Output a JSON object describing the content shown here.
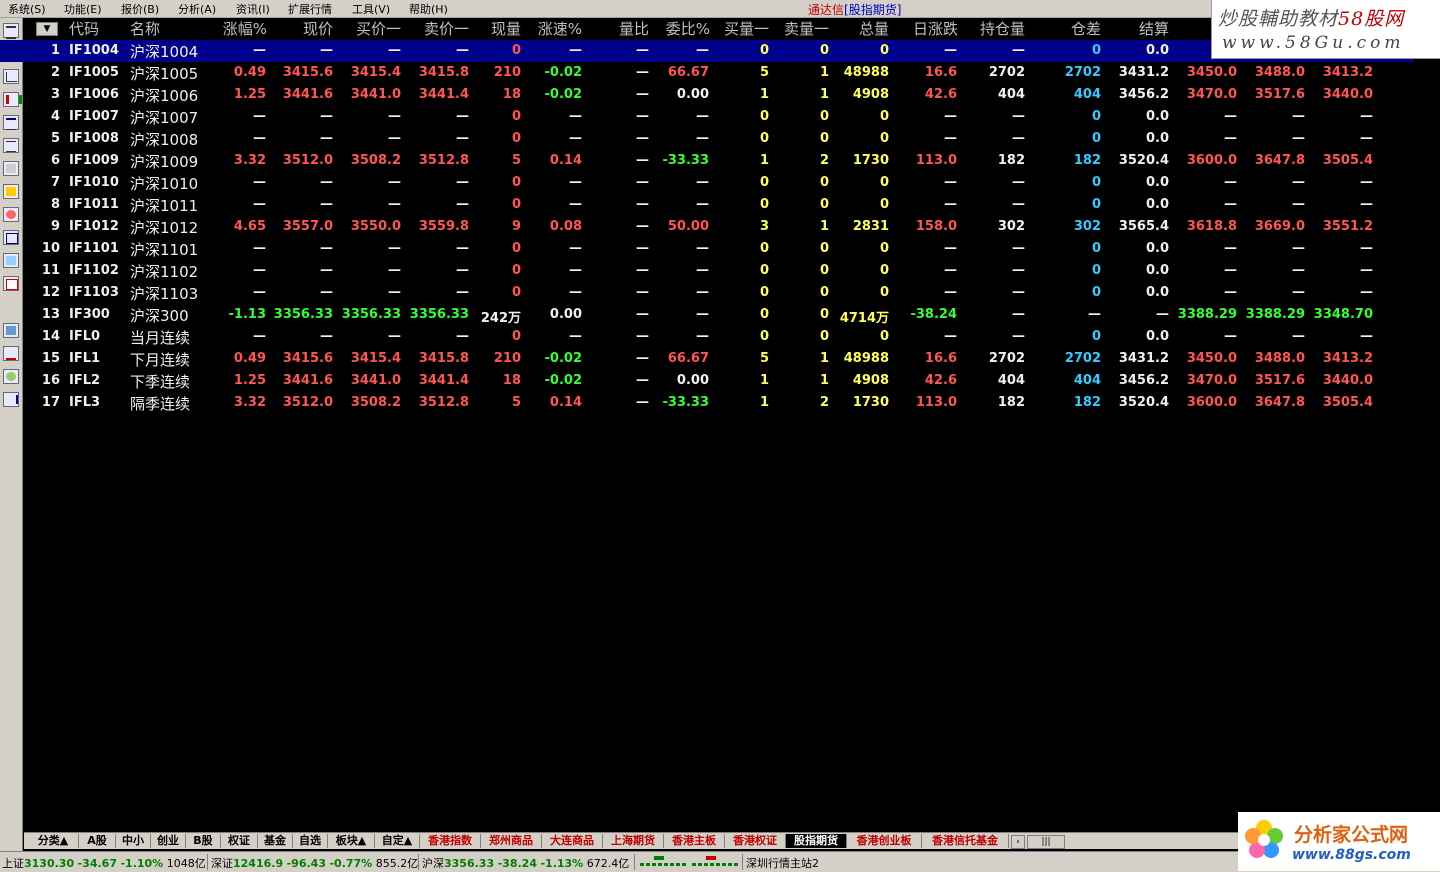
{
  "menu": {
    "items": [
      "系统(S)",
      "功能(E)",
      "报价(B)",
      "分析(A)",
      "资讯(I)",
      "扩展行情",
      "工具(V)",
      "帮助(H)"
    ],
    "app_title": "通达信",
    "app_subtitle": "[股指期货]"
  },
  "watermark_top": {
    "line1_a": "炒股輔助教材",
    "line1_b": "58股网",
    "line2": "www.58Gu.com"
  },
  "header": [
    "代码",
    "名称",
    "涨幅%",
    "现价",
    "买价一",
    "卖价一",
    "现量",
    "涨速%",
    "量比",
    "委比%",
    "买量一",
    "卖量一",
    "总量",
    "日涨跌",
    "持仓量",
    "仓差",
    "结算"
  ],
  "rows": [
    {
      "n": "1",
      "code": "IF1004",
      "name": "沪深1004",
      "chg": "—",
      "price": "—",
      "bid": "—",
      "ask": "—",
      "vol": "0",
      "speed": "—",
      "vr": "—",
      "wb": "—",
      "bv": "0",
      "av": "0",
      "tot": "0",
      "dchg": "—",
      "oi": "—",
      "oid": "0",
      "settle": "0.0",
      "x1": "—",
      "x2": "—",
      "x3": "—",
      "sel": true
    },
    {
      "n": "2",
      "code": "IF1005",
      "name": "沪深1005",
      "chg": "0.49",
      "price": "3415.6",
      "bid": "3415.4",
      "ask": "3415.8",
      "vol": "210",
      "speed": "-0.02",
      "vr": "—",
      "wb": "66.67",
      "bv": "5",
      "av": "1",
      "tot": "48988",
      "dchg": "16.6",
      "oi": "2702",
      "oid": "2702",
      "settle": "3431.2",
      "x1": "3450.0",
      "x2": "3488.0",
      "x3": "3413.2"
    },
    {
      "n": "3",
      "code": "IF1006",
      "name": "沪深1006",
      "chg": "1.25",
      "price": "3441.6",
      "bid": "3441.0",
      "ask": "3441.4",
      "vol": "18",
      "speed": "-0.02",
      "vr": "—",
      "wb": "0.00",
      "bv": "1",
      "av": "1",
      "tot": "4908",
      "dchg": "42.6",
      "oi": "404",
      "oid": "404",
      "settle": "3456.2",
      "x1": "3470.0",
      "x2": "3517.6",
      "x3": "3440.0"
    },
    {
      "n": "4",
      "code": "IF1007",
      "name": "沪深1007",
      "chg": "—",
      "price": "—",
      "bid": "—",
      "ask": "—",
      "vol": "0",
      "speed": "—",
      "vr": "—",
      "wb": "—",
      "bv": "0",
      "av": "0",
      "tot": "0",
      "dchg": "—",
      "oi": "—",
      "oid": "0",
      "settle": "0.0",
      "x1": "—",
      "x2": "—",
      "x3": "—"
    },
    {
      "n": "5",
      "code": "IF1008",
      "name": "沪深1008",
      "chg": "—",
      "price": "—",
      "bid": "—",
      "ask": "—",
      "vol": "0",
      "speed": "—",
      "vr": "—",
      "wb": "—",
      "bv": "0",
      "av": "0",
      "tot": "0",
      "dchg": "—",
      "oi": "—",
      "oid": "0",
      "settle": "0.0",
      "x1": "—",
      "x2": "—",
      "x3": "—"
    },
    {
      "n": "6",
      "code": "IF1009",
      "name": "沪深1009",
      "chg": "3.32",
      "price": "3512.0",
      "bid": "3508.2",
      "ask": "3512.8",
      "vol": "5",
      "speed": "0.14",
      "vr": "—",
      "wb": "-33.33",
      "bv": "1",
      "av": "2",
      "tot": "1730",
      "dchg": "113.0",
      "oi": "182",
      "oid": "182",
      "settle": "3520.4",
      "x1": "3600.0",
      "x2": "3647.8",
      "x3": "3505.4"
    },
    {
      "n": "7",
      "code": "IF1010",
      "name": "沪深1010",
      "chg": "—",
      "price": "—",
      "bid": "—",
      "ask": "—",
      "vol": "0",
      "speed": "—",
      "vr": "—",
      "wb": "—",
      "bv": "0",
      "av": "0",
      "tot": "0",
      "dchg": "—",
      "oi": "—",
      "oid": "0",
      "settle": "0.0",
      "x1": "—",
      "x2": "—",
      "x3": "—"
    },
    {
      "n": "8",
      "code": "IF1011",
      "name": "沪深1011",
      "chg": "—",
      "price": "—",
      "bid": "—",
      "ask": "—",
      "vol": "0",
      "speed": "—",
      "vr": "—",
      "wb": "—",
      "bv": "0",
      "av": "0",
      "tot": "0",
      "dchg": "—",
      "oi": "—",
      "oid": "0",
      "settle": "0.0",
      "x1": "—",
      "x2": "—",
      "x3": "—"
    },
    {
      "n": "9",
      "code": "IF1012",
      "name": "沪深1012",
      "chg": "4.65",
      "price": "3557.0",
      "bid": "3550.0",
      "ask": "3559.8",
      "vol": "9",
      "speed": "0.08",
      "vr": "—",
      "wb": "50.00",
      "bv": "3",
      "av": "1",
      "tot": "2831",
      "dchg": "158.0",
      "oi": "302",
      "oid": "302",
      "settle": "3565.4",
      "x1": "3618.8",
      "x2": "3669.0",
      "x3": "3551.2"
    },
    {
      "n": "10",
      "code": "IF1101",
      "name": "沪深1101",
      "chg": "—",
      "price": "—",
      "bid": "—",
      "ask": "—",
      "vol": "0",
      "speed": "—",
      "vr": "—",
      "wb": "—",
      "bv": "0",
      "av": "0",
      "tot": "0",
      "dchg": "—",
      "oi": "—",
      "oid": "0",
      "settle": "0.0",
      "x1": "—",
      "x2": "—",
      "x3": "—"
    },
    {
      "n": "11",
      "code": "IF1102",
      "name": "沪深1102",
      "chg": "—",
      "price": "—",
      "bid": "—",
      "ask": "—",
      "vol": "0",
      "speed": "—",
      "vr": "—",
      "wb": "—",
      "bv": "0",
      "av": "0",
      "tot": "0",
      "dchg": "—",
      "oi": "—",
      "oid": "0",
      "settle": "0.0",
      "x1": "—",
      "x2": "—",
      "x3": "—"
    },
    {
      "n": "12",
      "code": "IF1103",
      "name": "沪深1103",
      "chg": "—",
      "price": "—",
      "bid": "—",
      "ask": "—",
      "vol": "0",
      "speed": "—",
      "vr": "—",
      "wb": "—",
      "bv": "0",
      "av": "0",
      "tot": "0",
      "dchg": "—",
      "oi": "—",
      "oid": "0",
      "settle": "0.0",
      "x1": "—",
      "x2": "—",
      "x3": "—"
    },
    {
      "n": "13",
      "code": "IF300",
      "name": "沪深300",
      "chg": "-1.13",
      "price": "3356.33",
      "bid": "3356.33",
      "ask": "3356.33",
      "vol": "242万",
      "speed": "0.00",
      "vr": "—",
      "wb": "—",
      "bv": "0",
      "av": "0",
      "tot": "4714万",
      "dchg": "-38.24",
      "oi": "—",
      "oid": "—",
      "settle": "—",
      "x1": "3388.29",
      "x2": "3388.29",
      "x3": "3348.70",
      "index": true
    },
    {
      "n": "14",
      "code": "IFL0",
      "name": "当月连续",
      "chg": "—",
      "price": "—",
      "bid": "—",
      "ask": "—",
      "vol": "0",
      "speed": "—",
      "vr": "—",
      "wb": "—",
      "bv": "0",
      "av": "0",
      "tot": "0",
      "dchg": "—",
      "oi": "—",
      "oid": "0",
      "settle": "0.0",
      "x1": "—",
      "x2": "—",
      "x3": "—"
    },
    {
      "n": "15",
      "code": "IFL1",
      "name": "下月连续",
      "chg": "0.49",
      "price": "3415.6",
      "bid": "3415.4",
      "ask": "3415.8",
      "vol": "210",
      "speed": "-0.02",
      "vr": "—",
      "wb": "66.67",
      "bv": "5",
      "av": "1",
      "tot": "48988",
      "dchg": "16.6",
      "oi": "2702",
      "oid": "2702",
      "settle": "3431.2",
      "x1": "3450.0",
      "x2": "3488.0",
      "x3": "3413.2"
    },
    {
      "n": "16",
      "code": "IFL2",
      "name": "下季连续",
      "chg": "1.25",
      "price": "3441.6",
      "bid": "3441.0",
      "ask": "3441.4",
      "vol": "18",
      "speed": "-0.02",
      "vr": "—",
      "wb": "0.00",
      "bv": "1",
      "av": "1",
      "tot": "4908",
      "dchg": "42.6",
      "oi": "404",
      "oid": "404",
      "settle": "3456.2",
      "x1": "3470.0",
      "x2": "3517.6",
      "x3": "3440.0"
    },
    {
      "n": "17",
      "code": "IFL3",
      "name": "隔季连续",
      "chg": "3.32",
      "price": "3512.0",
      "bid": "3508.2",
      "ask": "3512.8",
      "vol": "5",
      "speed": "0.14",
      "vr": "—",
      "wb": "-33.33",
      "bv": "1",
      "av": "2",
      "tot": "1730",
      "dchg": "113.0",
      "oi": "182",
      "oid": "182",
      "settle": "3520.4",
      "x1": "3600.0",
      "x2": "3647.8",
      "x3": "3505.4"
    }
  ],
  "tabs": [
    {
      "label": "分类▲",
      "red": false
    },
    {
      "label": "A股",
      "red": false
    },
    {
      "label": "中小",
      "red": false
    },
    {
      "label": "创业",
      "red": false
    },
    {
      "label": "B股",
      "red": false
    },
    {
      "label": "权证",
      "red": false
    },
    {
      "label": "基金",
      "red": false
    },
    {
      "label": "自选",
      "red": false
    },
    {
      "label": "板块▲",
      "red": false
    },
    {
      "label": "自定▲",
      "red": false
    },
    {
      "label": "香港指数",
      "red": true
    },
    {
      "label": "郑州商品",
      "red": true
    },
    {
      "label": "大连商品",
      "red": true
    },
    {
      "label": "上海期货",
      "red": true
    },
    {
      "label": "香港主板",
      "red": true
    },
    {
      "label": "香港权证",
      "red": true
    },
    {
      "label": "股指期货",
      "red": false,
      "active": true
    },
    {
      "label": "香港创业板",
      "red": true
    },
    {
      "label": "香港信托基金",
      "red": true
    }
  ],
  "status": {
    "sh_label": "上证",
    "sh_val": "3130.30",
    "sh_chg": "-34.67",
    "sh_pct": "-1.10%",
    "sh_amt": "1048亿",
    "sz_label": "深证",
    "sz_val": "12416.9",
    "sz_chg": "-96.43",
    "sz_pct": "-0.77%",
    "sz_amt": "855.2亿",
    "hs_label": "沪深",
    "hs_val": "3356.33",
    "hs_chg": "-38.24",
    "hs_pct": "-1.13%",
    "hs_amt": "672.4亿",
    "server": "深圳行情主站2"
  },
  "watermark_bottom": {
    "title": "分析家公式网",
    "url": "www.88gs.com"
  },
  "colors": {
    "up": "#ff5555",
    "down": "#33ff33",
    "neutral": "#f0f0f0",
    "volume": "#ffff55",
    "oi_change": "#33ccff",
    "selection": "#00008b"
  }
}
